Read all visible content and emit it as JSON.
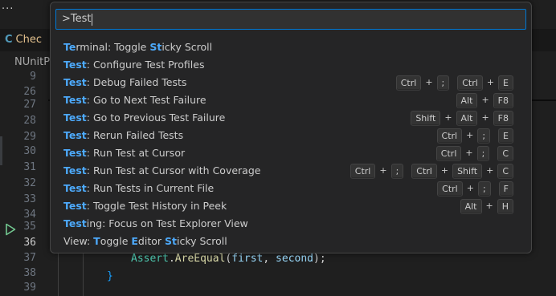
{
  "topbar": {
    "more": "..."
  },
  "editor": {
    "tab_label": "Chec",
    "tab_icon": "C",
    "breadcrumb": "NUnitP",
    "line_numbers": [
      "9",
      "26",
      "27",
      "28",
      "29",
      "30",
      "31",
      "32",
      "33",
      "34",
      "35",
      "36",
      "37",
      "38",
      "39"
    ],
    "current_line": "36",
    "code": {
      "assert_class": "Assert",
      "assert_dot": ".",
      "assert_method": "AreEqual",
      "open_paren": "(",
      "arg1": "first",
      "comma": ", ",
      "arg2": "second",
      "close": ");",
      "brace": "}"
    }
  },
  "quick_pick": {
    "input_value": ">Test",
    "items": [
      {
        "segments": [
          {
            "t": "Te",
            "h": true
          },
          {
            "t": "rminal: Toggle ",
            "h": false
          },
          {
            "t": "St",
            "h": true
          },
          {
            "t": "icky Scroll",
            "h": false
          }
        ],
        "keybinding": []
      },
      {
        "segments": [
          {
            "t": "Test",
            "h": true
          },
          {
            "t": ": Configure Test Profiles",
            "h": false
          }
        ],
        "keybinding": []
      },
      {
        "segments": [
          {
            "t": "Test",
            "h": true
          },
          {
            "t": ": Debug Failed Tests",
            "h": false
          }
        ],
        "keybinding": [
          [
            "Ctrl",
            ";"
          ],
          [
            "Ctrl",
            "E"
          ]
        ]
      },
      {
        "segments": [
          {
            "t": "Test",
            "h": true
          },
          {
            "t": ": Go to Next Test Failure",
            "h": false
          }
        ],
        "keybinding": [
          [
            "Alt",
            "F8"
          ]
        ]
      },
      {
        "segments": [
          {
            "t": "Test",
            "h": true
          },
          {
            "t": ": Go to Previous Test Failure",
            "h": false
          }
        ],
        "keybinding": [
          [
            "Shift",
            "Alt",
            "F8"
          ]
        ]
      },
      {
        "segments": [
          {
            "t": "Test",
            "h": true
          },
          {
            "t": ": Rerun Failed Tests",
            "h": false
          }
        ],
        "keybinding": [
          [
            "Ctrl",
            ";"
          ],
          [
            "E"
          ]
        ]
      },
      {
        "segments": [
          {
            "t": "Test",
            "h": true
          },
          {
            "t": ": Run Test at Cursor",
            "h": false
          }
        ],
        "keybinding": [
          [
            "Ctrl",
            ";"
          ],
          [
            "C"
          ]
        ]
      },
      {
        "segments": [
          {
            "t": "Test",
            "h": true
          },
          {
            "t": ": Run Test at Cursor with Coverage",
            "h": false
          }
        ],
        "keybinding": [
          [
            "Ctrl",
            ";"
          ],
          [
            "Ctrl",
            "Shift",
            "C"
          ]
        ]
      },
      {
        "segments": [
          {
            "t": "Test",
            "h": true
          },
          {
            "t": ": Run Tests in Current File",
            "h": false
          }
        ],
        "keybinding": [
          [
            "Ctrl",
            ";"
          ],
          [
            "F"
          ]
        ]
      },
      {
        "segments": [
          {
            "t": "Test",
            "h": true
          },
          {
            "t": ": Toggle Test History in Peek",
            "h": false
          }
        ],
        "keybinding": [
          [
            "Alt",
            "H"
          ]
        ]
      },
      {
        "segments": [
          {
            "t": "Test",
            "h": true
          },
          {
            "t": "ing: Focus on Test Explorer View",
            "h": false
          }
        ],
        "keybinding": []
      },
      {
        "segments": [
          {
            "t": "View: ",
            "h": false
          },
          {
            "t": "T",
            "h": true
          },
          {
            "t": "oggle ",
            "h": false
          },
          {
            "t": "E",
            "h": true
          },
          {
            "t": "ditor ",
            "h": false
          },
          {
            "t": "St",
            "h": true
          },
          {
            "t": "icky Scroll",
            "h": false
          }
        ],
        "keybinding": []
      }
    ],
    "plus_sign": "+"
  }
}
